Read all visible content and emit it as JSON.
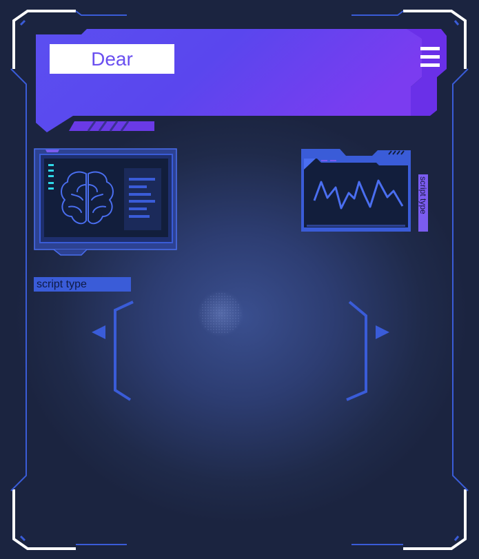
{
  "header": {
    "title": "Dear",
    "menu_icon": "hamburger-menu-icon"
  },
  "brain_panel": {
    "icon": "brain-icon",
    "indicator_count": 5,
    "text_lines": 7
  },
  "chart_panel": {
    "icon": "waveform-chart-icon",
    "vertical_label": "script type"
  },
  "script_label": "script type",
  "navigation": {
    "prev_icon": "left-arrow-icon",
    "next_icon": "right-arrow-icon"
  },
  "colors": {
    "background": "#1a2238",
    "accent_blue": "#3a5cd8",
    "accent_purple": "#7b3cf0",
    "line_blue": "#4a6ef0",
    "indicator_cyan": "#2fd8e8",
    "title_text": "#6a4ff0"
  }
}
